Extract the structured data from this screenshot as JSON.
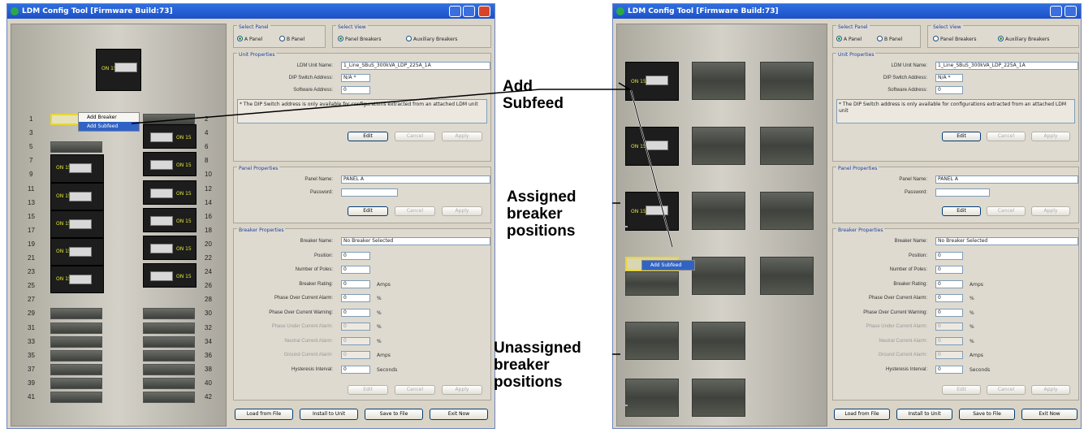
{
  "window_title": "LDM Config Tool [Firmware Build:73]",
  "select_panel": {
    "legend": "Select Panel",
    "options": [
      "A Panel",
      "B Panel"
    ]
  },
  "select_view": {
    "legend": "Select View",
    "options": [
      "Panel Breakers",
      "Auxiliary Breakers"
    ]
  },
  "unit_properties": {
    "legend": "Unit Properties",
    "ldm_unit_name_label": "LDM Unit Name:",
    "ldm_unit_name_value": "1_Line_SBuS_300kVA_LDP_225A_1A",
    "dip_switch_label": "DIP Switch Address:",
    "dip_switch_value": "N/A *",
    "software_address_label": "Software Address:",
    "software_address_value": "0",
    "note": "* The DIP Switch address is only available for configurations extracted from an attached LDM unit"
  },
  "panel_properties": {
    "legend": "Panel Properties",
    "panel_name_label": "Panel Name:",
    "panel_name_value": "PANEL A",
    "password_label": "Password:",
    "password_value": ""
  },
  "breaker_properties": {
    "legend": "Breaker Properties",
    "rows": [
      {
        "label": "Breaker Name:",
        "value": "No Breaker Selected",
        "unit": "",
        "dim": false
      },
      {
        "label": "Position:",
        "value": "0",
        "unit": "",
        "dim": false
      },
      {
        "label": "Number of Poles:",
        "value": "0",
        "unit": "",
        "dim": false
      },
      {
        "label": "Breaker Rating:",
        "value": "0",
        "unit": "Amps",
        "dim": false
      },
      {
        "label": "Phase Over Current Alarm:",
        "value": "0",
        "unit": "%",
        "dim": false
      },
      {
        "label": "Phase Over Current Warning:",
        "value": "0",
        "unit": "%",
        "dim": false
      },
      {
        "label": "Phase Under Current Alarm:",
        "value": "0",
        "unit": "%",
        "dim": true
      },
      {
        "label": "Neutral Current Alarm:",
        "value": "0",
        "unit": "%",
        "dim": true
      },
      {
        "label": "Ground Current Alarm:",
        "value": "0",
        "unit": "Amps",
        "dim": true
      },
      {
        "label": "Hysteresis Interval:",
        "value": "0",
        "unit": "Seconds",
        "dim": false
      }
    ]
  },
  "buttons": {
    "edit": "Edit",
    "cancel": "Cancel",
    "apply": "Apply"
  },
  "footer_buttons": [
    "Load from File",
    "Install to Unit",
    "Save to File",
    "Exit Now"
  ],
  "breaker_text": "ON  15",
  "context_menu": {
    "add_breaker": "Add Breaker",
    "add_subfeed": "Add Subfeed"
  },
  "left_numbers_odd": [
    "1",
    "3",
    "5",
    "7",
    "9",
    "11",
    "13",
    "15",
    "17",
    "19",
    "21",
    "23",
    "25",
    "27",
    "29",
    "31",
    "33",
    "35",
    "37",
    "39",
    "41"
  ],
  "left_numbers_even": [
    "2",
    "4",
    "6",
    "8",
    "10",
    "12",
    "14",
    "16",
    "18",
    "20",
    "22",
    "24",
    "26",
    "28",
    "30",
    "32",
    "34",
    "36",
    "38",
    "40",
    "42"
  ],
  "annotations": {
    "add_subfeed": "Add\nSubfeed",
    "assigned": "Assigned\nbreaker\npositions",
    "unassigned": "Unassigned\nbreaker\npositions"
  }
}
